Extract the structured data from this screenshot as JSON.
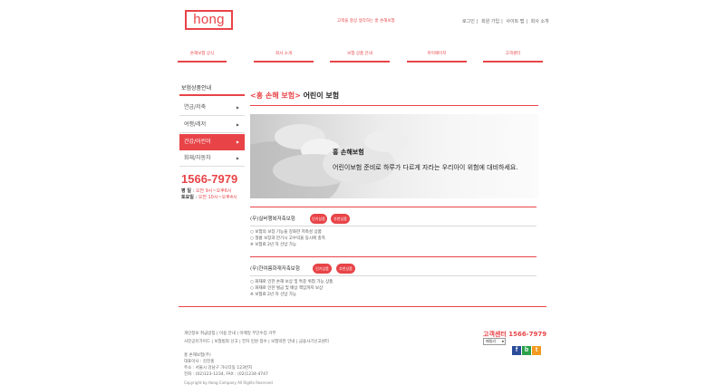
{
  "header": {
    "logo_text": "hong",
    "slogan": "고객을 항상 생각하는 홍 손해보험",
    "util_links": [
      "로그인",
      "회원 가입",
      "사이트 맵",
      "회사 소개"
    ]
  },
  "gnb": [
    "손해보험 상식",
    "회사 소개",
    "보험 상품 안내",
    "마이페이지",
    "고객센터"
  ],
  "sidebar": {
    "title": "보험상품안내",
    "items": [
      {
        "label": "연금/저축",
        "arrow": "▶"
      },
      {
        "label": "여행/레저",
        "arrow": "▶"
      },
      {
        "label": "건강/어린이",
        "arrow": "▶"
      },
      {
        "label": "화재/자동차",
        "arrow": "▶"
      }
    ],
    "phone": "1566-7979",
    "hours": [
      {
        "label": "평 일",
        "value": "오전 9시~오후6시"
      },
      {
        "label": "토요일",
        "value": "오전 10시~오후4시"
      }
    ]
  },
  "main": {
    "title_prefix": "<홍 손해 보험>",
    "title_suffix": " 어린이 보험",
    "banner": {
      "name": "홍 손해보험",
      "desc": "어린이보험 준비로 하루가 다르게 자라는 우리아이 위험에 대비하세요."
    },
    "products": [
      {
        "name": "(무)실버행복저축보험",
        "badges": [
          "인기상품",
          "추천상품"
        ],
        "bullets": [
          "○ 보험의 보장 기능을 강화한 저축성 상품",
          "○ 절릉 보장과 만기시 고수익을 동시에 충족",
          "※ 보험료 2년 자 선납 가능"
        ]
      },
      {
        "name": "(무)한여름화재저축보험",
        "badges": [
          "인기상품",
          "추천상품"
        ],
        "bullets": [
          "○ 화재로 인한 손해 보상 및 특종 위험 가능 상품",
          "○ 화재로 인한 벌금 및 배상 책임까지 보상",
          "※ 보험료 2년 자 선납 가능"
        ]
      }
    ]
  },
  "footer": {
    "links_row1": [
      "개인정보 취급방침",
      "이용 안내",
      "이메일 무단수집 거부"
    ],
    "links_row2": [
      "사진공유가이드",
      "보험범죄 신고",
      "전자 민원 접수",
      "보험약관 안내",
      "금융사기신고센터"
    ],
    "company": "홍 손해보험(주)",
    "ceo": "대표이사 : 김진홍",
    "address": "주소 : 서울시 강남구 가나다동 123번지",
    "tel": "전화 : (02)123-1234, FAX : (02)1234-4747",
    "copyright": "Copyright by Hong Company All Rights Reserved",
    "callcenter_label": "고객센터",
    "callcenter_phone": "1566-7979",
    "select_value": "패밀리",
    "sns": [
      {
        "name": "facebook",
        "glyph": "f",
        "color": "#2b4c9b"
      },
      {
        "name": "blog",
        "glyph": "b",
        "color": "#2aa14a"
      },
      {
        "name": "twitter",
        "glyph": "t",
        "color": "#f29a1f"
      }
    ]
  }
}
